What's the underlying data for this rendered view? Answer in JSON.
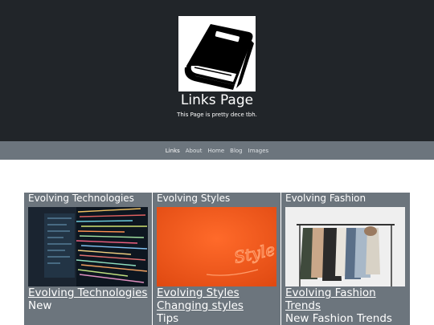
{
  "header": {
    "title": "Links Page",
    "tagline": "This Page is pretty dece tbh.",
    "logo_icon": "book-icon"
  },
  "nav": {
    "items": [
      "Links",
      "About",
      "Home",
      "Blog",
      "Images"
    ],
    "active": "Links"
  },
  "cards": [
    {
      "heading": "Evolving Technologies",
      "image": "code-screen-image",
      "link": "Evolving Technologies",
      "text": "New"
    },
    {
      "heading": "Evolving Styles",
      "image": "orange-style-fabric-image",
      "image_text": "Style",
      "link": "Evolving Styles",
      "link2": "Changing styles",
      "text": "Tips"
    },
    {
      "heading": "Evolving Fashion",
      "image": "clothing-rack-image",
      "link": "Evolving Fashion Trends",
      "text": "New Fashion Trends"
    }
  ],
  "colors": {
    "header_bg": "#212529",
    "nav_bg": "#6c757d",
    "card_bg": "#6c757d"
  }
}
